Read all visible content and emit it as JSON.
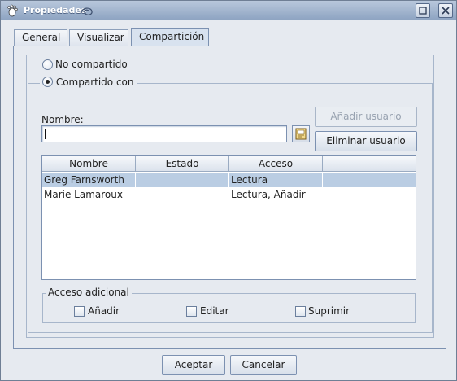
{
  "window": {
    "title": "Propiedades"
  },
  "tabs": [
    {
      "label": "General"
    },
    {
      "label": "Visualizar"
    },
    {
      "label": "Compartición",
      "selected": true
    }
  ],
  "sharing": {
    "option_not_shared": "No compartido",
    "option_shared_with": "Compartido con",
    "selected_option": "Compartido con"
  },
  "name_field": {
    "label": "Nombre:",
    "value": ""
  },
  "buttons": {
    "add_user": "Añadir usuario",
    "remove_user": "Eliminar usuario",
    "ok": "Aceptar",
    "cancel": "Cancelar"
  },
  "table": {
    "headers": [
      "Nombre",
      "Estado",
      "Acceso",
      ""
    ],
    "rows": [
      {
        "nombre": "Greg Farnsworth",
        "estado": "",
        "acceso": "Lectura",
        "selected": true
      },
      {
        "nombre": "Marie Lamaroux",
        "estado": "",
        "acceso": "Lectura, Añadir",
        "selected": false
      }
    ]
  },
  "additional_access": {
    "legend": "Acceso adicional",
    "options": [
      {
        "label": "Añadir",
        "checked": false
      },
      {
        "label": "Editar",
        "checked": false
      },
      {
        "label": "Suprimir",
        "checked": false
      }
    ]
  },
  "icons": {
    "app": "gnome-foot-icon",
    "minimize": "minimize-icon",
    "close": "close-icon",
    "address_book": "address-book-icon"
  }
}
